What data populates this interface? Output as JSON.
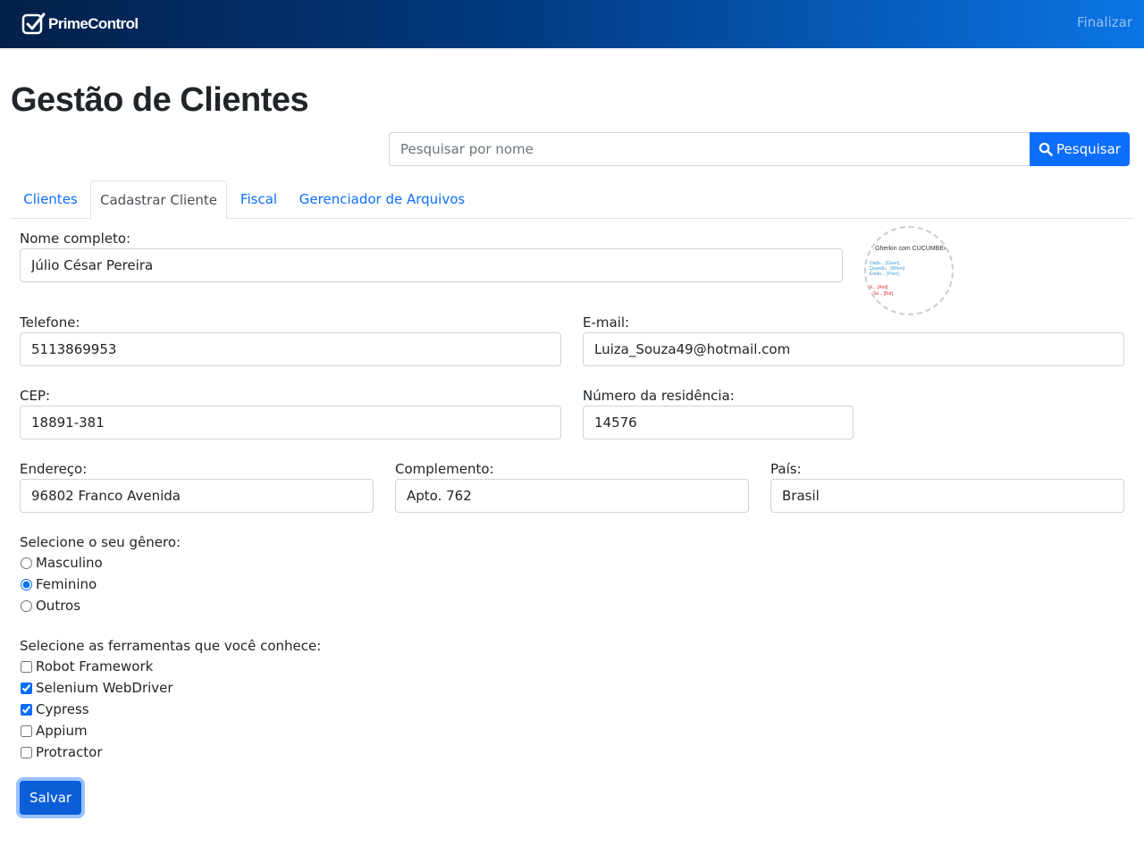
{
  "brand": {
    "name": "PrimeControl"
  },
  "nav": {
    "finalizar": "Finalizar"
  },
  "page": {
    "title": "Gestão de Clientes"
  },
  "search": {
    "placeholder": "Pesquisar por nome",
    "value": "",
    "button_label": "Pesquisar"
  },
  "tabs": [
    {
      "label": "Clientes",
      "active": false
    },
    {
      "label": "Cadastrar Cliente",
      "active": true
    },
    {
      "label": "Fiscal",
      "active": false
    },
    {
      "label": "Gerenciador de Arquivos",
      "active": false
    }
  ],
  "form": {
    "nome": {
      "label": "Nome completo:",
      "value": "Júlio César Pereira"
    },
    "telefone": {
      "label": "Telefone:",
      "value": "5113869953"
    },
    "email": {
      "label": "E-mail:",
      "value": "Luiza_Souza49@hotmail.com"
    },
    "cep": {
      "label": "CEP:",
      "value": "18891-381"
    },
    "numero": {
      "label": "Número da residência:",
      "value": "14576"
    },
    "endereco": {
      "label": "Endereço:",
      "value": "96802 Franco Avenida"
    },
    "complemento": {
      "label": "Complemento:",
      "value": "Apto. 762"
    },
    "pais": {
      "label": "País:",
      "value": "Brasil"
    },
    "genero": {
      "label": "Selecione o seu gênero:",
      "options": [
        {
          "label": "Masculino",
          "checked": false
        },
        {
          "label": "Feminino",
          "checked": true
        },
        {
          "label": "Outros",
          "checked": false
        }
      ]
    },
    "ferramentas": {
      "label": "Selecione as ferramentas que você conhece:",
      "options": [
        {
          "label": "Robot Framework",
          "checked": false
        },
        {
          "label": "Selenium WebDriver",
          "checked": true
        },
        {
          "label": "Cypress",
          "checked": true
        },
        {
          "label": "Appium",
          "checked": false
        },
        {
          "label": "Protractor",
          "checked": false
        }
      ]
    },
    "save_label": "Salvar"
  },
  "avatar_image": {
    "title": "Gherkin com CUCUMBER",
    "lines_blue": [
      "Dado... [Given]",
      "Quando... [When]",
      "Então... [Then]"
    ],
    "lines_red": [
      "E... [And]",
      "Se... [But]"
    ]
  },
  "colors": {
    "primary": "#0d6efd",
    "navbar_start": "#03204a",
    "navbar_end": "#0b75e6"
  }
}
